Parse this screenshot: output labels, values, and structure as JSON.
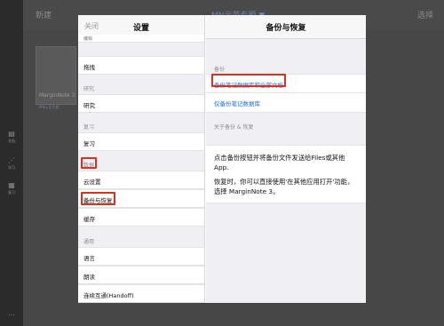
{
  "background": {
    "topbar_left": "新建",
    "topbar_center": "MN示范专题 ▼",
    "topbar_right": "选择",
    "card_title": "MarginNote 3",
    "card_subtitle": "MN示范专题",
    "rail_items": [
      {
        "icon": "document-icon",
        "label": "文档"
      },
      {
        "icon": "study-icon",
        "label": "学习"
      },
      {
        "icon": "review-icon",
        "label": "复习"
      }
    ],
    "rail_more": "…"
  },
  "settings": {
    "close_label": "关闭",
    "title": "设置",
    "cut_top": "编辑",
    "rows_a": [
      "拖拽"
    ],
    "section_research": "研究",
    "rows_research": [
      "研究"
    ],
    "section_review": "复习",
    "rows_review": [
      "复习"
    ],
    "section_data": "数据",
    "rows_data": [
      "云设置",
      "备份与恢复",
      "缓存"
    ],
    "section_general": "通用",
    "rows_general": [
      "语言",
      "朗读",
      "连续互通(Handoff)"
    ]
  },
  "backup": {
    "title": "备份与恢复",
    "section_backup": "备份",
    "option_full": "备份笔记数据库和全部文档",
    "option_db_only": "仅备份笔记数据库",
    "section_about": "关于备份 & 恢复",
    "desc_1": "点击备份按钮并将备份文件发送给Files或其他 App.",
    "desc_2": "恢复时，你可以直接使用'在其他应用打开'功能，选择 MarginNote 3。"
  },
  "colors": {
    "highlight": "#e02d1c",
    "link_blue": "#1a6fdf"
  }
}
